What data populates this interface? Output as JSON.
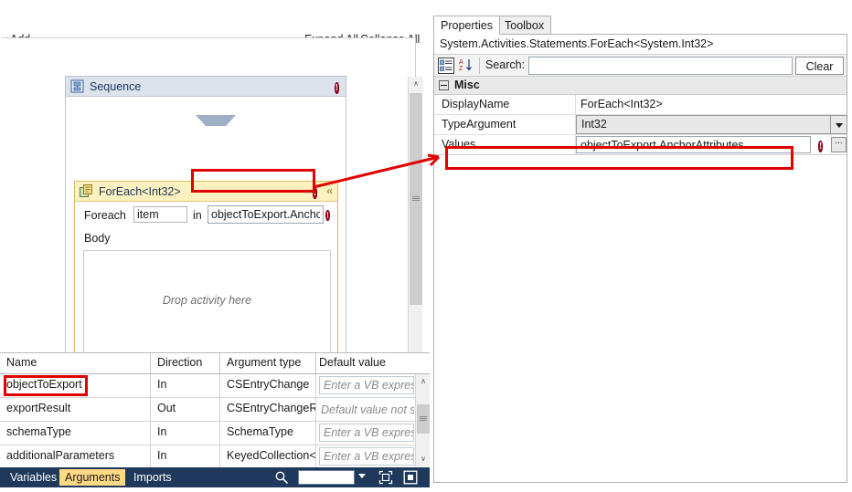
{
  "designer": {
    "commands": {
      "add": "Add",
      "expand_all": "Expand All",
      "collapse_all": "Collapse All"
    },
    "sequence": {
      "title": "Sequence",
      "icon": "sequence-icon",
      "error_glyph": "!"
    },
    "foreach": {
      "title": "ForEach<Int32>",
      "icon": "foreach-icon",
      "error_glyph": "!",
      "collapse_glyph": "«",
      "foreach_label": "Foreach",
      "item_value": "item",
      "in_label": "in",
      "values_value": "objectToExport.AnchorAttributes",
      "values_error_glyph": "!",
      "body_label": "Body",
      "dropzone_text": "Drop activity here"
    },
    "scrollbar": {
      "up_glyph": "∧",
      "down_glyph": "∨"
    }
  },
  "arguments_grid": {
    "columns": [
      "Name",
      "Direction",
      "Argument type",
      "Default value"
    ],
    "rows": [
      {
        "name": "objectToExport",
        "direction": "In",
        "type": "CSEntryChange",
        "default": "Enter a VB express",
        "default_boxed": true
      },
      {
        "name": "exportResult",
        "direction": "Out",
        "type": "CSEntryChangeRes",
        "default": "Default value not su",
        "default_boxed": false
      },
      {
        "name": "schemaType",
        "direction": "In",
        "type": "SchemaType",
        "default": "Enter a VB express",
        "default_boxed": true
      },
      {
        "name": "additionalParameters",
        "direction": "In",
        "type": "KeyedCollection<S",
        "default": "Enter a VB express",
        "default_boxed": true
      }
    ]
  },
  "status_bar": {
    "tabs": [
      {
        "label": "Variables",
        "active": false
      },
      {
        "label": "Arguments",
        "active": true
      },
      {
        "label": "Imports",
        "active": false
      }
    ],
    "search_icon": "magnifier-icon",
    "zoom_value": "",
    "fit_icon": "fit-to-screen-icon",
    "overview_icon": "overview-map-icon"
  },
  "right_panel": {
    "tabs": [
      {
        "label": "Properties",
        "active": true
      },
      {
        "label": "Toolbox",
        "active": false
      }
    ],
    "type_name": "System.Activities.Statements.ForEach<System.Int32>",
    "toolbar": {
      "categorized_icon": "categorized-view-icon",
      "alphabetical_icon": "alphabetical-sort-icon",
      "search_label": "Search:",
      "search_value": "",
      "clear_label": "Clear"
    },
    "category": {
      "label": "Misc",
      "expander_glyph": "-"
    },
    "properties": [
      {
        "name": "DisplayName",
        "value": "ForEach<Int32>"
      },
      {
        "name": "TypeArgument",
        "value": "Int32"
      },
      {
        "name": "Values",
        "value": "objectToExport.AnchorAttributes"
      }
    ],
    "values_row": {
      "error_glyph": "!",
      "ellipsis_label": "..."
    }
  },
  "colors": {
    "accent_blue": "#1e395b",
    "error_red": "#a8001c",
    "annotation_red": "#e00000",
    "highlight_yellow": "#ffd983",
    "foreach_header": "#fdf1bf",
    "sequence_header": "#dce3ec"
  }
}
